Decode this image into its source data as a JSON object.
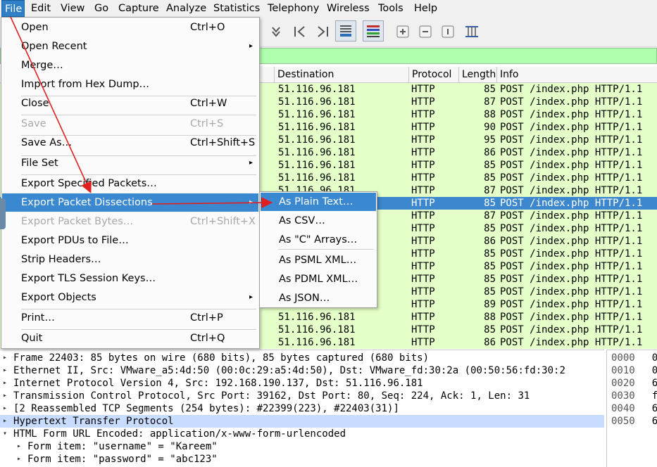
{
  "menubar": {
    "items": [
      "File",
      "Edit",
      "View",
      "Go",
      "Capture",
      "Analyze",
      "Statistics",
      "Telephony",
      "Wireless",
      "Tools",
      "Help"
    ]
  },
  "packet_list": {
    "columns": [
      "Destination",
      "Protocol",
      "Length",
      "Info"
    ],
    "rows": [
      {
        "dst": "51.116.96.181",
        "proto": "HTTP",
        "len": "85",
        "info": "POST /index.php HTTP/1.1"
      },
      {
        "dst": "51.116.96.181",
        "proto": "HTTP",
        "len": "87",
        "info": "POST /index.php HTTP/1.1"
      },
      {
        "dst": "51.116.96.181",
        "proto": "HTTP",
        "len": "88",
        "info": "POST /index.php HTTP/1.1"
      },
      {
        "dst": "51.116.96.181",
        "proto": "HTTP",
        "len": "90",
        "info": "POST /index.php HTTP/1.1"
      },
      {
        "dst": "51.116.96.181",
        "proto": "HTTP",
        "len": "95",
        "info": "POST /index.php HTTP/1.1"
      },
      {
        "dst": "51.116.96.181",
        "proto": "HTTP",
        "len": "86",
        "info": "POST /index.php HTTP/1.1"
      },
      {
        "dst": "51.116.96.181",
        "proto": "HTTP",
        "len": "85",
        "info": "POST /index.php HTTP/1.1"
      },
      {
        "dst": "51.116.96.181",
        "proto": "HTTP",
        "len": "85",
        "info": "POST /index.php HTTP/1.1"
      },
      {
        "dst": "51.116.96.181",
        "proto": "HTTP",
        "len": "87",
        "info": "POST /index.php HTTP/1.1"
      },
      {
        "dst": "",
        "proto": "HTTP",
        "len": "85",
        "info": "POST /index.php HTTP/1.1"
      },
      {
        "dst": "",
        "proto": "HTTP",
        "len": "87",
        "info": "POST /index.php HTTP/1.1"
      },
      {
        "dst": "",
        "proto": "HTTP",
        "len": "85",
        "info": "POST /index.php HTTP/1.1"
      },
      {
        "dst": "",
        "proto": "HTTP",
        "len": "86",
        "info": "POST /index.php HTTP/1.1"
      },
      {
        "dst": "",
        "proto": "HTTP",
        "len": "85",
        "info": "POST /index.php HTTP/1.1"
      },
      {
        "dst": "",
        "proto": "HTTP",
        "len": "85",
        "info": "POST /index.php HTTP/1.1"
      },
      {
        "dst": "",
        "proto": "HTTP",
        "len": "85",
        "info": "POST /index.php HTTP/1.1"
      },
      {
        "dst": "",
        "proto": "HTTP",
        "len": "85",
        "info": "POST /index.php HTTP/1.1"
      },
      {
        "dst": "",
        "proto": "HTTP",
        "len": "89",
        "info": "POST /index.php HTTP/1.1"
      },
      {
        "dst": "51.116.96.181",
        "proto": "HTTP",
        "len": "88",
        "info": "POST /index.php HTTP/1.1"
      },
      {
        "dst": "51.116.96.181",
        "proto": "HTTP",
        "len": "85",
        "info": "POST /index.php HTTP/1.1"
      },
      {
        "dst": "51.116.96.181",
        "proto": "HTTP",
        "len": "86",
        "info": "POST /index.php HTTP/1.1"
      }
    ],
    "selected_row": 9
  },
  "details": {
    "rows": [
      {
        "arrow": "▸",
        "indent": 0,
        "text": "Frame 22403: 85 bytes on wire (680 bits), 85 bytes captured (680 bits)"
      },
      {
        "arrow": "▸",
        "indent": 0,
        "text": "Ethernet II, Src: VMware_a5:4d:50 (00:0c:29:a5:4d:50), Dst: VMware_fd:30:2a (00:50:56:fd:30:2"
      },
      {
        "arrow": "▸",
        "indent": 0,
        "text": "Internet Protocol Version 4, Src: 192.168.190.137, Dst: 51.116.96.181"
      },
      {
        "arrow": "▸",
        "indent": 0,
        "text": "Transmission Control Protocol, Src Port: 39162, Dst Port: 80, Seq: 224, Ack: 1, Len: 31"
      },
      {
        "arrow": "▸",
        "indent": 0,
        "text": "[2 Reassembled TCP Segments (254 bytes): #22399(223), #22403(31)]"
      },
      {
        "arrow": "▸",
        "indent": 0,
        "text": "Hypertext Transfer Protocol"
      },
      {
        "arrow": "▾",
        "indent": 0,
        "text": "HTML Form URL Encoded: application/x-www-form-urlencoded"
      },
      {
        "arrow": "▸",
        "indent": 1,
        "text": "Form item: \"username\" = \"Kareem\""
      },
      {
        "arrow": "▸",
        "indent": 1,
        "text": "Form item: \"password\" = \"abc123\""
      }
    ],
    "highlighted_row": 5
  },
  "hex": {
    "rows": [
      {
        "off": "0000",
        "b": "0"
      },
      {
        "off": "0010",
        "b": "0"
      },
      {
        "off": "0020",
        "b": "6"
      },
      {
        "off": "0030",
        "b": "f"
      },
      {
        "off": "0040",
        "b": "6"
      },
      {
        "off": "0050",
        "b": "6"
      }
    ]
  },
  "file_menu": {
    "items": [
      {
        "label": "Open",
        "shortcut": "Ctrl+O",
        "arrow": false,
        "disabled": false
      },
      {
        "label": "Open Recent",
        "shortcut": "",
        "arrow": true,
        "disabled": false
      },
      {
        "label": "Merge…",
        "shortcut": "",
        "arrow": false,
        "disabled": false
      },
      {
        "label": "Import from Hex Dump…",
        "shortcut": "",
        "arrow": false,
        "disabled": false
      },
      {
        "label": "Close",
        "shortcut": "Ctrl+W",
        "arrow": false,
        "disabled": false
      },
      {
        "label": "Save",
        "shortcut": "Ctrl+S",
        "arrow": false,
        "disabled": true
      },
      {
        "label": "Save As…",
        "shortcut": "Ctrl+Shift+S",
        "arrow": false,
        "disabled": false
      },
      {
        "label": "File Set",
        "shortcut": "",
        "arrow": true,
        "disabled": false
      },
      {
        "label": "Export Specified Packets…",
        "shortcut": "",
        "arrow": false,
        "disabled": false
      },
      {
        "label": "Export Packet Dissections",
        "shortcut": "",
        "arrow": true,
        "disabled": false
      },
      {
        "label": "Export Packet Bytes…",
        "shortcut": "Ctrl+Shift+X",
        "arrow": false,
        "disabled": true
      },
      {
        "label": "Export PDUs to File…",
        "shortcut": "",
        "arrow": false,
        "disabled": false
      },
      {
        "label": "Strip Headers…",
        "shortcut": "",
        "arrow": false,
        "disabled": false
      },
      {
        "label": "Export TLS Session Keys…",
        "shortcut": "",
        "arrow": false,
        "disabled": false
      },
      {
        "label": "Export Objects",
        "shortcut": "",
        "arrow": true,
        "disabled": false
      },
      {
        "label": "Print…",
        "shortcut": "Ctrl+P",
        "arrow": false,
        "disabled": false
      },
      {
        "label": "Quit",
        "shortcut": "Ctrl+Q",
        "arrow": false,
        "disabled": false
      }
    ],
    "highlighted": 9
  },
  "export_submenu": {
    "items": [
      "As Plain Text…",
      "As CSV…",
      "As \"C\" Arrays…",
      "As PSML XML…",
      "As PDML XML…",
      "As JSON…"
    ],
    "highlighted": 0
  },
  "colors": {
    "accent": "#3a88d0",
    "row_bg": "#e4ffc7",
    "filter_bg": "#afffaf",
    "annotation": "#e02020"
  },
  "icons": [
    "find-packet-icon",
    "go-first-icon",
    "go-last-icon",
    "autoscroll-icon",
    "colorize-icon",
    "zoom-in-icon",
    "zoom-out-icon",
    "zoom-normal-icon",
    "resize-columns-icon"
  ]
}
